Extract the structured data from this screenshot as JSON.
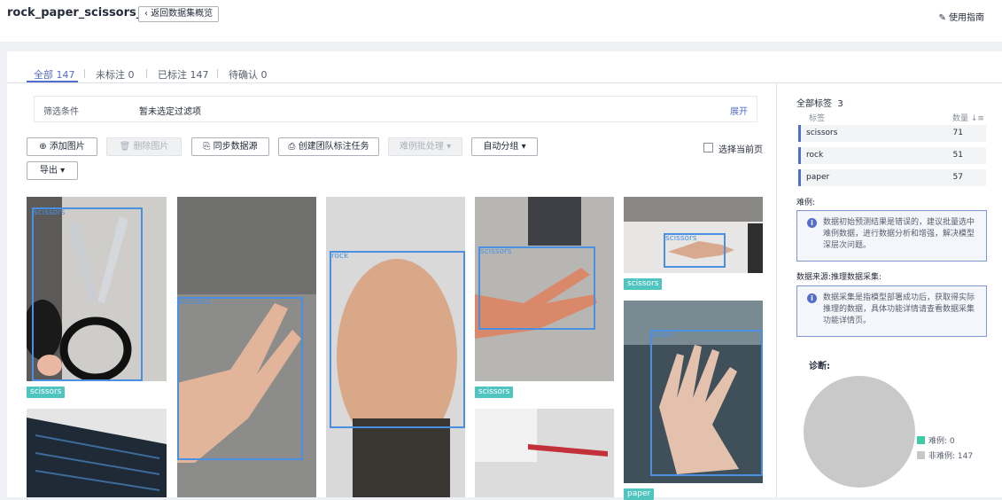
{
  "header": {
    "title": "rock_paper_scissors_train",
    "back_label": "返回数据集概览",
    "guide_label": "使用指南"
  },
  "tabs": [
    {
      "label": "全部 147"
    },
    {
      "label": "未标注 0"
    },
    {
      "label": "已标注 147"
    },
    {
      "label": "待确认 0"
    }
  ],
  "filter": {
    "label": "筛选条件",
    "value": "暂未选定过滤项",
    "expand": "展开"
  },
  "toolbar": {
    "add_image": "添加图片",
    "delete_image": "删除图片",
    "sync_source": "同步数据源",
    "create_team_task": "创建团队标注任务",
    "hard_example": "难例批处理",
    "auto_group": "自动分组",
    "export": "导出",
    "select_page": "选择当前页"
  },
  "images": [
    {
      "tag": "scissors",
      "box_label": "scissors"
    },
    {
      "tag": "",
      "box_label": "scissors"
    },
    {
      "tag": "",
      "box_label": "rock"
    },
    {
      "tag": "scissors",
      "box_label": "scissors"
    },
    {
      "tag": "scissors",
      "box_label": "scissors"
    },
    {
      "tag": "paper",
      "box_label": "paper"
    }
  ],
  "sidebar": {
    "all_labels_title": "全部标签",
    "label_count": "3",
    "col_label": "标签",
    "col_count": "数量",
    "labels": [
      {
        "name": "scissors",
        "count": "71"
      },
      {
        "name": "rock",
        "count": "51"
      },
      {
        "name": "paper",
        "count": "57"
      }
    ],
    "hard_title": "难例:",
    "hard_info": "数据初始预测结果是错误的，建议批量选中难例数据，进行数据分析和增强，解决模型深层次问题。",
    "source_title": "数据来源:推理数据采集:",
    "source_info": "数据采集是指模型部署成功后，获取得实际推理的数据，具体功能详情请查看数据采集功能详情页。",
    "diag_title": "诊断:",
    "legend": [
      {
        "label": "难例: 0",
        "color": "#3dcca6"
      },
      {
        "label": "非难例: 147",
        "color": "#c7c7c7"
      }
    ]
  }
}
